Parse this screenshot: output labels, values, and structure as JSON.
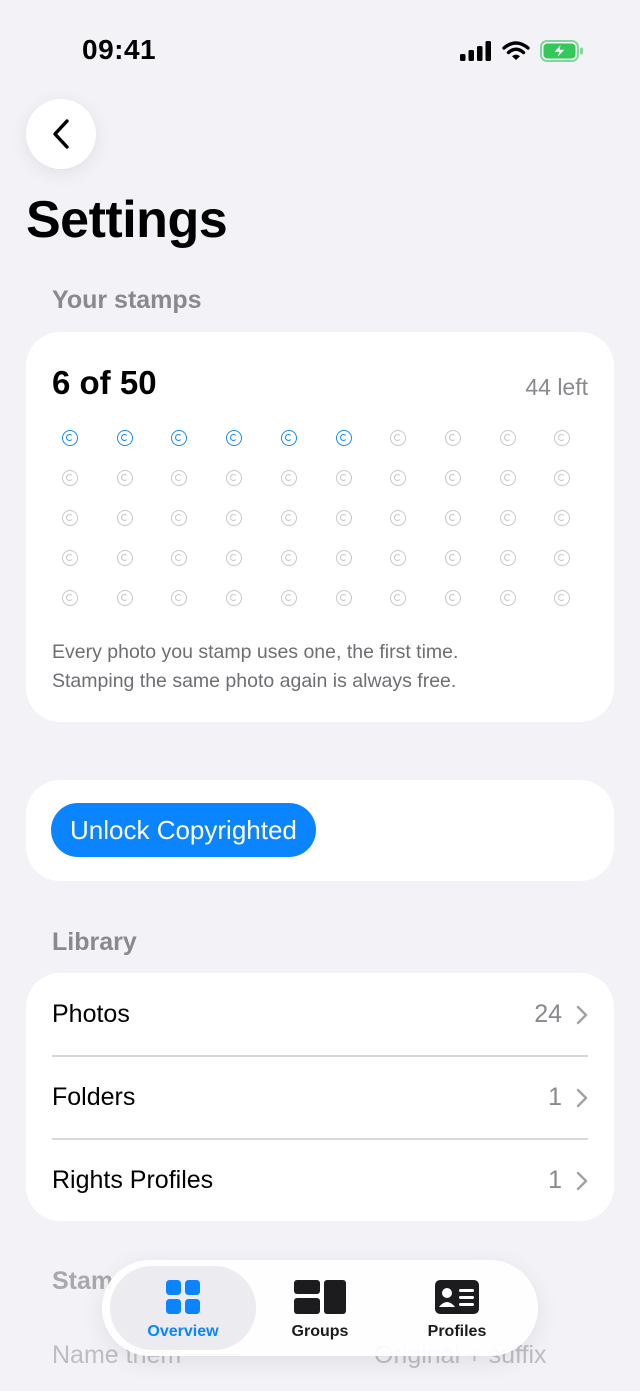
{
  "status_bar": {
    "time": "09:41",
    "battery_color": "#34c759"
  },
  "header": {
    "title": "Settings"
  },
  "stamps": {
    "section_label": "Your stamps",
    "count_text": "6 of 50",
    "left_text": "44 left",
    "used": 6,
    "total": 50,
    "used_color": "#1a8ae6",
    "unused_color": "#c7c7cc",
    "note_line1": "Every photo you stamp uses one, the first time.",
    "note_line2": "Stamping the same photo again is always free."
  },
  "unlock": {
    "button_label": "Unlock Copyrighted",
    "accent": "#0a84ff"
  },
  "library": {
    "section_label": "Library",
    "rows": [
      {
        "label": "Photos",
        "count": "24"
      },
      {
        "label": "Folders",
        "count": "1"
      },
      {
        "label": "Rights Profiles",
        "count": "1"
      }
    ]
  },
  "peek": {
    "section_label": "Stam",
    "row_label": "Name them",
    "row_value": "Original + suffix"
  },
  "tab_bar": {
    "tabs": [
      {
        "label": "Overview",
        "icon": "grid-icon",
        "active": true
      },
      {
        "label": "Groups",
        "icon": "groups-icon",
        "active": false
      },
      {
        "label": "Profiles",
        "icon": "id-card-icon",
        "active": false
      }
    ]
  }
}
